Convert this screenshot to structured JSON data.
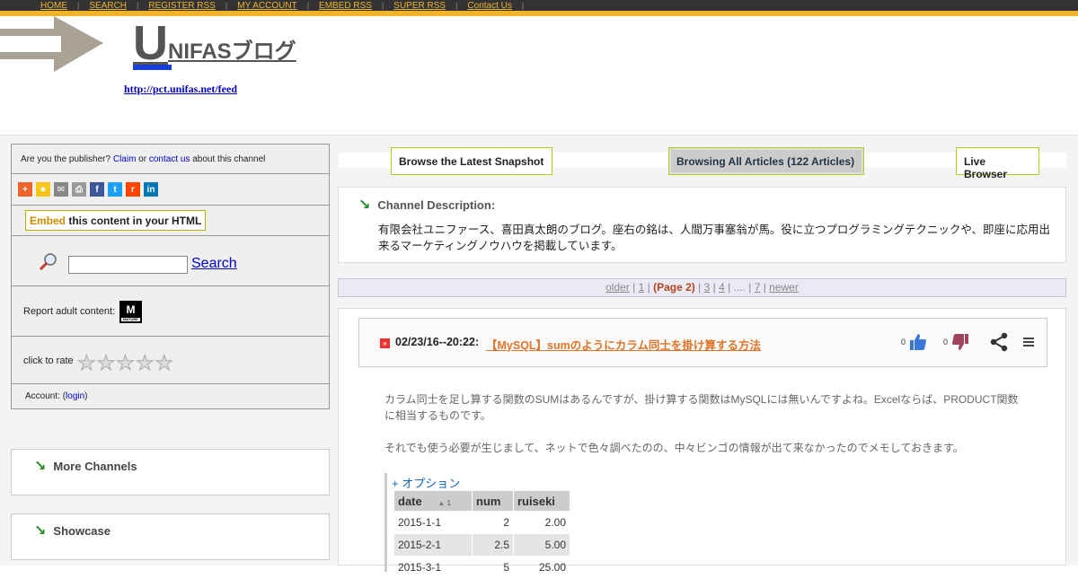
{
  "nav": {
    "items": [
      "HOME",
      "SEARCH",
      "REGISTER RSS",
      "MY ACCOUNT",
      "EMBED RSS",
      "SUPER RSS",
      "Contact Us"
    ]
  },
  "header": {
    "title_initial": "U",
    "title_rest": "NIFASブログ",
    "feed_url": "http://pct.unifas.net/feed"
  },
  "sidebar": {
    "publisher_prefix": "Are you the publisher? ",
    "claim_label": "Claim",
    "or_text": " or ",
    "contact_label": "contact us",
    "publisher_suffix": " about this channel",
    "share_icons": [
      "add-icon",
      "star-icon",
      "email-icon",
      "print-icon",
      "facebook-icon",
      "twitter-icon",
      "reddit-icon",
      "linkedin-icon"
    ],
    "embed_word": "Embed",
    "embed_rest": " this content in your HTML",
    "search_label": "Search",
    "report_label": "Report adult content:",
    "rate_label": "click to rate",
    "account_prefix": "Account: (",
    "login_label": "login",
    "account_suffix": ")",
    "more_channels": "More Channels",
    "showcase": "Showcase"
  },
  "tabs": {
    "latest": "Browse the Latest Snapshot",
    "all": "Browsing All Articles (122 Articles)",
    "live": "Live Browser"
  },
  "channel": {
    "title": "Channel Description:",
    "description": "有限会社ユニファース、喜田真太朗のブログ。座右の銘は、人間万事塞翁が馬。役に立つプログラミングテクニックや、即座に応用出来るマーケティングノウハウを掲載しています。"
  },
  "pager": {
    "older": "older",
    "p1": "1",
    "current": "(Page 2)",
    "p3": "3",
    "p4": "4",
    "ellipsis": "....",
    "p7": "7",
    "newer": "newer"
  },
  "article": {
    "date": "02/23/16--20:22:",
    "title": "【MySQL】sumのようにカラム同士を掛け算する方法",
    "upvotes": "0",
    "downvotes": "0",
    "para1": "カラム同士を足し算する関数のSUMはあるんですが、掛け算する関数はMySQLには無いんですよね。Excelならば、PRODUCT関数に相当するものです。",
    "para2": "それでも使う必要が生じまして、ネットで色々調べたのの、中々ビンゴの情報が出て来なかったのでメモしておきます。",
    "table": {
      "option_label": "+ オプション",
      "headers": [
        "date",
        "num",
        "ruiseki"
      ],
      "sort_marker": "▲ 1",
      "rows": [
        [
          "2015-1-1",
          "2",
          "2.00"
        ],
        [
          "2015-2-1",
          "2.5",
          "5.00"
        ],
        [
          "2015-3-1",
          "5",
          "25.00"
        ]
      ]
    }
  }
}
